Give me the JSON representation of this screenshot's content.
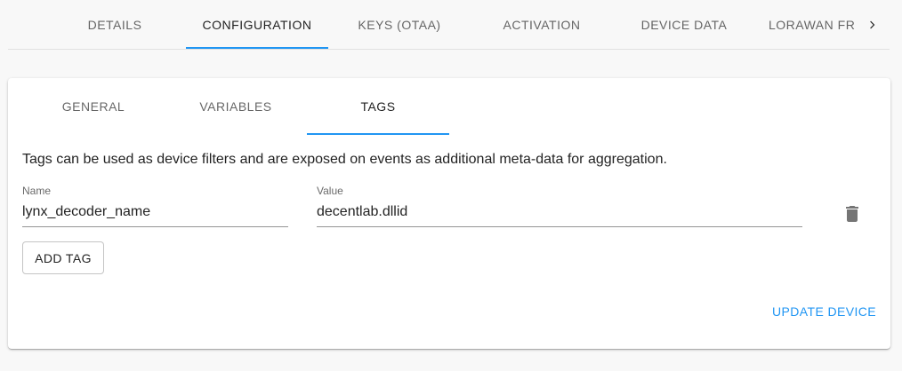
{
  "top_tabs": [
    {
      "label": "DETAILS",
      "active": false
    },
    {
      "label": "CONFIGURATION",
      "active": true
    },
    {
      "label": "KEYS (OTAA)",
      "active": false
    },
    {
      "label": "ACTIVATION",
      "active": false
    },
    {
      "label": "DEVICE DATA",
      "active": false
    },
    {
      "label": "LORAWAN FRA",
      "active": false
    }
  ],
  "top_tabs_next_icon": "chevron-right-icon",
  "sub_tabs": [
    {
      "label": "GENERAL",
      "active": false
    },
    {
      "label": "VARIABLES",
      "active": false
    },
    {
      "label": "TAGS",
      "active": true
    }
  ],
  "tags": {
    "description": "Tags can be used as device filters and are exposed on events as additional meta-data for aggregation.",
    "rows": [
      {
        "name_label": "Name",
        "name_value": "lynx_decoder_name",
        "value_label": "Value",
        "value_value": "decentlab.dllid",
        "delete_icon": "trash-icon"
      }
    ],
    "add_button": "ADD TAG"
  },
  "update_button": "UPDATE DEVICE",
  "colors": {
    "accent": "#2196f3",
    "background": "#f8f8f8",
    "card": "#ffffff"
  }
}
